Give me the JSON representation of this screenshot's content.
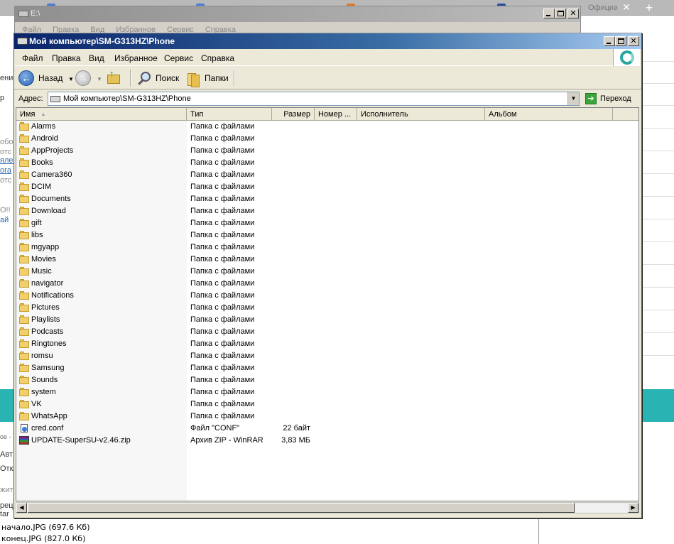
{
  "background": {
    "tabs": [
      {
        "label": "",
        "color": "#4a7bd5"
      },
      {
        "label": "",
        "color": "#4a7bd5"
      },
      {
        "label": "",
        "color": "#e07a2a"
      },
      {
        "label": "Официальн...",
        "color": "#2a4aa0"
      }
    ],
    "tab_close": "✕",
    "new_tab": "+",
    "left_fragments": [
      "ение",
      "р",
      "обо",
      "отс",
      "ялес",
      "ога",
      "отс",
      "О!!",
      "ай",
      "ое -",
      "Авт",
      "Отк",
      "жить",
      "рец",
      "tar"
    ],
    "attachments": [
      "начало.JPG (697.6 Кб)",
      "конец.JPG (827.0 Кб)"
    ]
  },
  "back_window": {
    "title": "E:\\",
    "menu": [
      "Файл",
      "Правка",
      "Вид",
      "Избранное",
      "Сервис",
      "Справка"
    ]
  },
  "window": {
    "title": "Мой компьютер\\SM-G313HZ\\Phone",
    "menu": [
      "Файл",
      "Правка",
      "Вид",
      "Избранное",
      "Сервис",
      "Справка"
    ],
    "toolbar": {
      "back_label": "Назад",
      "search_label": "Поиск",
      "folders_label": "Папки"
    },
    "address": {
      "label": "Адрес:",
      "value": "Мой компьютер\\SM-G313HZ\\Phone",
      "go_label": "Переход"
    },
    "columns": {
      "name": "Имя",
      "type": "Тип",
      "size": "Размер",
      "number": "Номер ...",
      "artist": "Исполнитель",
      "album": "Альбом"
    },
    "files": [
      {
        "name": "Alarms",
        "type": "Папка с файлами",
        "size": "",
        "kind": "folder"
      },
      {
        "name": "Android",
        "type": "Папка с файлами",
        "size": "",
        "kind": "folder"
      },
      {
        "name": "AppProjects",
        "type": "Папка с файлами",
        "size": "",
        "kind": "folder"
      },
      {
        "name": "Books",
        "type": "Папка с файлами",
        "size": "",
        "kind": "folder"
      },
      {
        "name": "Camera360",
        "type": "Папка с файлами",
        "size": "",
        "kind": "folder"
      },
      {
        "name": "DCIM",
        "type": "Папка с файлами",
        "size": "",
        "kind": "folder"
      },
      {
        "name": "Documents",
        "type": "Папка с файлами",
        "size": "",
        "kind": "folder"
      },
      {
        "name": "Download",
        "type": "Папка с файлами",
        "size": "",
        "kind": "folder"
      },
      {
        "name": "gift",
        "type": "Папка с файлами",
        "size": "",
        "kind": "folder"
      },
      {
        "name": "libs",
        "type": "Папка с файлами",
        "size": "",
        "kind": "folder"
      },
      {
        "name": "mgyapp",
        "type": "Папка с файлами",
        "size": "",
        "kind": "folder"
      },
      {
        "name": "Movies",
        "type": "Папка с файлами",
        "size": "",
        "kind": "folder"
      },
      {
        "name": "Music",
        "type": "Папка с файлами",
        "size": "",
        "kind": "folder"
      },
      {
        "name": "navigator",
        "type": "Папка с файлами",
        "size": "",
        "kind": "folder"
      },
      {
        "name": "Notifications",
        "type": "Папка с файлами",
        "size": "",
        "kind": "folder"
      },
      {
        "name": "Pictures",
        "type": "Папка с файлами",
        "size": "",
        "kind": "folder"
      },
      {
        "name": "Playlists",
        "type": "Папка с файлами",
        "size": "",
        "kind": "folder"
      },
      {
        "name": "Podcasts",
        "type": "Папка с файлами",
        "size": "",
        "kind": "folder"
      },
      {
        "name": "Ringtones",
        "type": "Папка с файлами",
        "size": "",
        "kind": "folder"
      },
      {
        "name": "romsu",
        "type": "Папка с файлами",
        "size": "",
        "kind": "folder"
      },
      {
        "name": "Samsung",
        "type": "Папка с файлами",
        "size": "",
        "kind": "folder"
      },
      {
        "name": "Sounds",
        "type": "Папка с файлами",
        "size": "",
        "kind": "folder"
      },
      {
        "name": "system",
        "type": "Папка с файлами",
        "size": "",
        "kind": "folder"
      },
      {
        "name": "VK",
        "type": "Папка с файлами",
        "size": "",
        "kind": "folder"
      },
      {
        "name": "WhatsApp",
        "type": "Папка с файлами",
        "size": "",
        "kind": "folder"
      },
      {
        "name": "cred.conf",
        "type": "Файл \"CONF\"",
        "size": "22 байт",
        "kind": "conf"
      },
      {
        "name": "UPDATE-SuperSU-v2.46.zip",
        "type": "Архив ZIP - WinRAR",
        "size": "3,83 МБ",
        "kind": "zip"
      }
    ]
  },
  "colors": {
    "teal_band": "#29b3b3",
    "title_active": "#0a246a",
    "window_face": "#ece9d8"
  }
}
